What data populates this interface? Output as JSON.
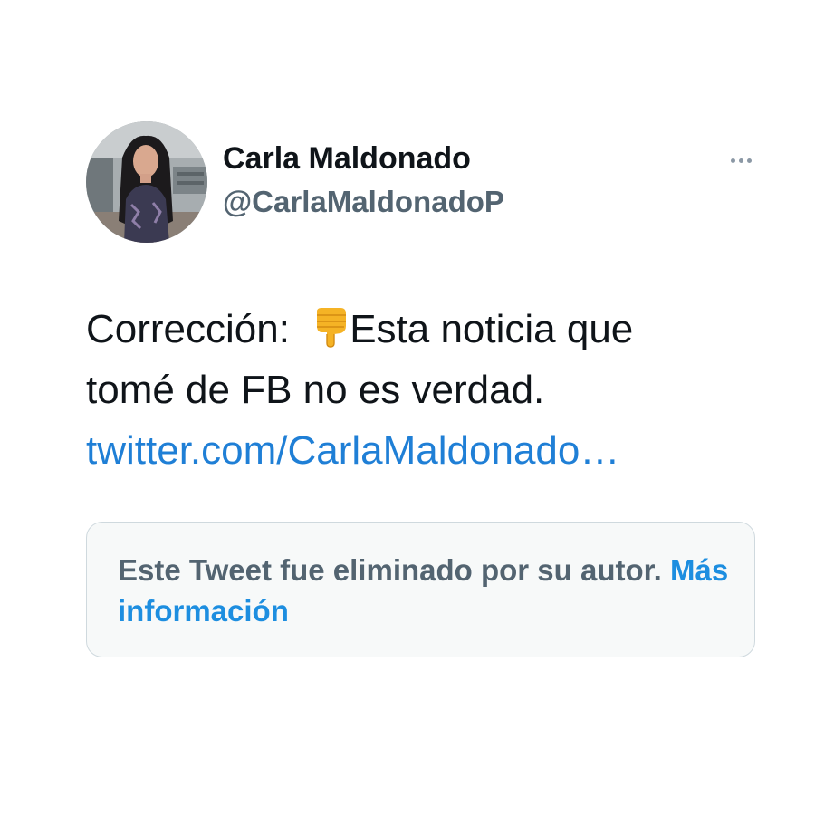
{
  "author": {
    "name": "Carla Maldonado",
    "handle": "@CarlaMaldonadoP",
    "avatar_icon": "profile-photo"
  },
  "more_icon": "more-dots-icon",
  "tweet": {
    "line1_prefix": "Corrección: ",
    "emoji_icon": "backhand-index-pointing-down-icon",
    "line1_suffix": "Esta noticia que",
    "line2": "tomé de FB no es verdad.",
    "link_text": "twitter.com/CarlaMaldonado…"
  },
  "quoted_tweet": {
    "deleted_message": "Este Tweet fue eliminado por su autor.",
    "learn_more_label": "Más información"
  },
  "colors": {
    "link": "#1d9bf0",
    "secondary_text": "#536471",
    "primary_text": "#0f1419",
    "card_background": "#f7f9f9",
    "card_border": "#cfd9de"
  }
}
